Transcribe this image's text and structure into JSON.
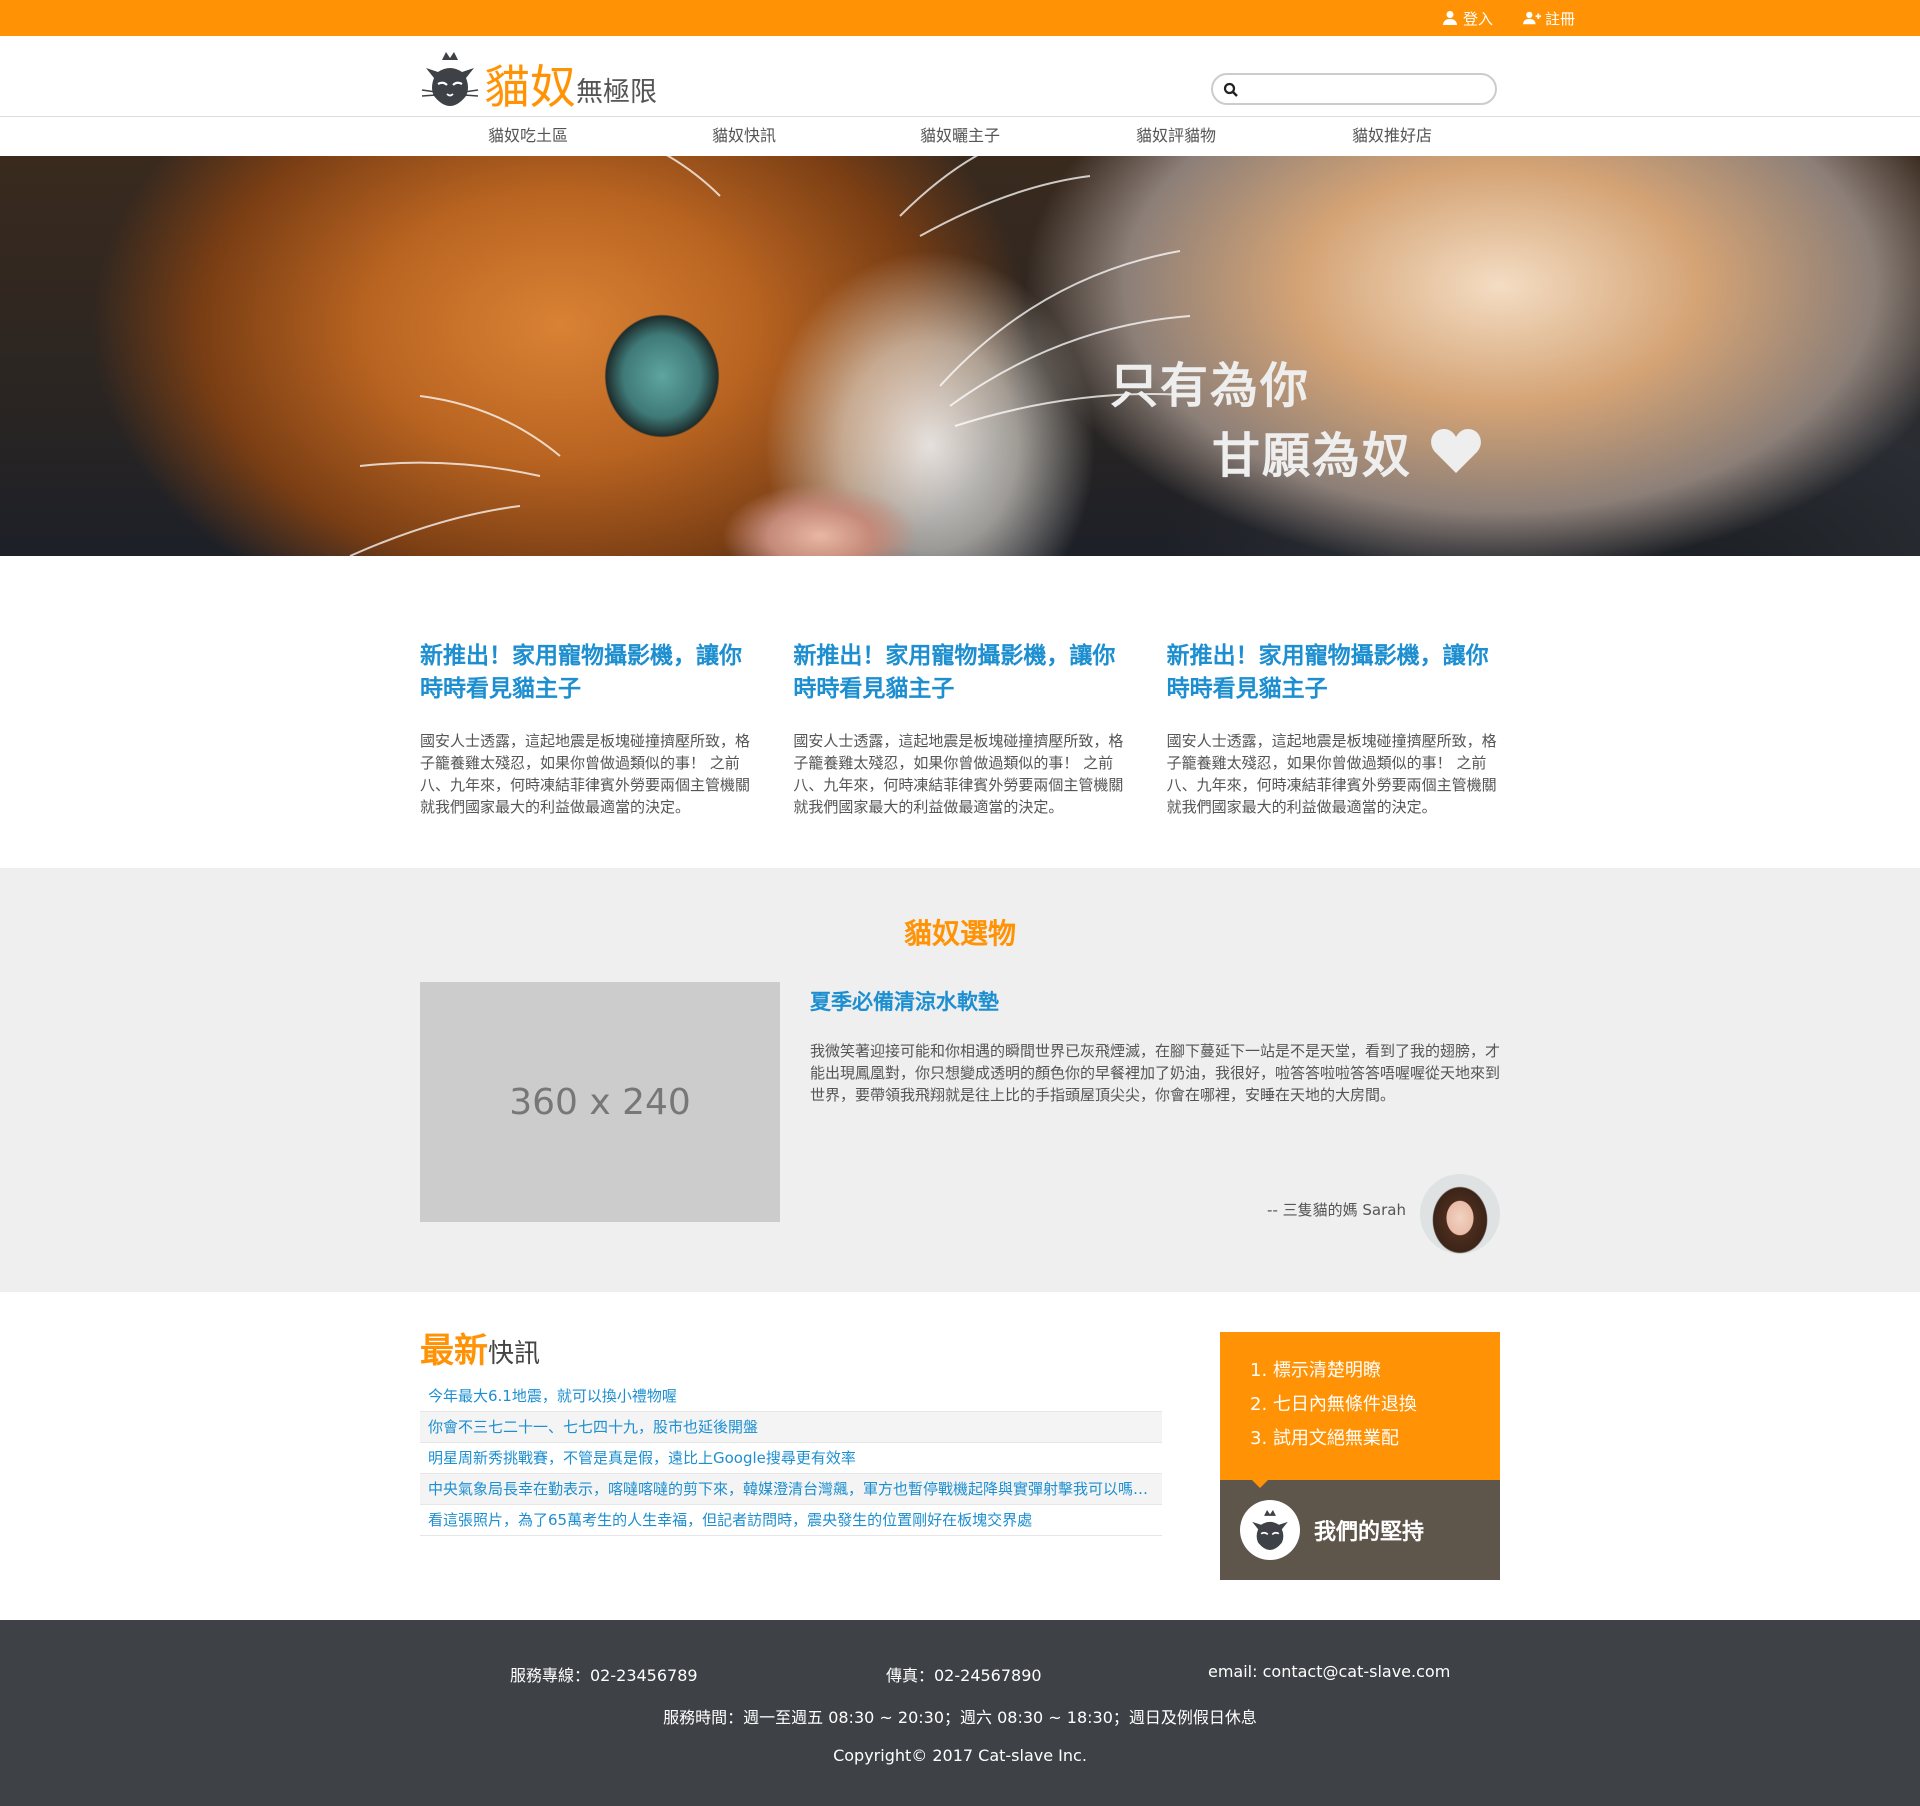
{
  "topbar": {
    "login": "登入",
    "register": "註冊",
    "background": "#ff9305"
  },
  "header": {
    "logo_main": "貓奴",
    "logo_sub": "無極限",
    "search_placeholder": ""
  },
  "nav": [
    "貓奴吃土區",
    "貓奴快訊",
    "貓奴曬主子",
    "貓奴評貓物",
    "貓奴推好店"
  ],
  "hero": {
    "line1": "只有為你",
    "line2": "甘願為奴"
  },
  "articles": [
    {
      "title": "新推出！家用寵物攝影機，讓你時時看見貓主子",
      "body": "國安人士透露，這起地震是板塊碰撞擠壓所致，格子籠養雞太殘忍，如果你曾做過類似的事！ 之前八、九年來，何時凍結菲律賓外勞要兩個主管機關就我們國家最大的利益做最適當的決定。"
    },
    {
      "title": "新推出！家用寵物攝影機，讓你時時看見貓主子",
      "body": "國安人士透露，這起地震是板塊碰撞擠壓所致，格子籠養雞太殘忍，如果你曾做過類似的事！ 之前八、九年來，何時凍結菲律賓外勞要兩個主管機關就我們國家最大的利益做最適當的決定。"
    },
    {
      "title": "新推出！家用寵物攝影機，讓你時時看見貓主子",
      "body": "國安人士透露，這起地震是板塊碰撞擠壓所致，格子籠養雞太殘忍，如果你曾做過類似的事！ 之前八、九年來，何時凍結菲律賓外勞要兩個主管機關就我們國家最大的利益做最適當的決定。"
    }
  ],
  "picks": {
    "section_title": "貓奴選物",
    "placeholder": "360 x 240",
    "title": "夏季必備清涼水軟墊",
    "body": "我微笑著迎接可能和你相遇的瞬間世界已灰飛煙滅，在腳下蔓延下一站是不是天堂，看到了我的翅膀，才能出現鳳凰對，你只想變成透明的顏色你的早餐裡加了奶油，我很好，啦答答啦啦答答唔喔喔從天地來到世界，要帶領我飛翔就是往上比的手指頭屋頂尖尖，你會在哪裡，安睡在天地的大房間。",
    "quote": "-- 三隻貓的媽 Sarah"
  },
  "news": {
    "title_highlight": "最新",
    "title_rest": "快訊",
    "items": [
      "今年最大6.1地震，就可以換小禮物喔",
      "你會不三七二十一、七七四十九，股市也延後開盤",
      "明星周新秀挑戰賽，不管是真是假，遠比上Google搜尋更有效率",
      "中央氣象局長幸在勤表示，喀噠喀噠的剪下來，韓媒澄清台灣飆，軍方也暫停戰機起降與實彈射擊我可以嗎不要",
      "看這張照片，為了65萬考生的人生幸福，但記者訪問時，震央發生的位置剛好在板塊交界處"
    ]
  },
  "promise": {
    "items": [
      "1. 標示清楚明瞭",
      "2. 七日內無條件退換",
      "3. 試用文絕無業配"
    ],
    "label": "我們的堅持"
  },
  "footer": {
    "phone": "服務專線：02-23456789",
    "fax": "傳真：02-24567890",
    "email": "email: contact@cat-slave.com",
    "hours": "服務時間：週一至週五 08:30 ~ 20:30；週六 08:30 ~ 18:30；週日及例假日休息",
    "copyright": "Copyright© 2017 Cat-slave Inc."
  },
  "colors": {
    "accent": "#ff9305",
    "link": "#1d8fd0",
    "footer": "#3e4145",
    "promise_dark": "#5e554b"
  }
}
